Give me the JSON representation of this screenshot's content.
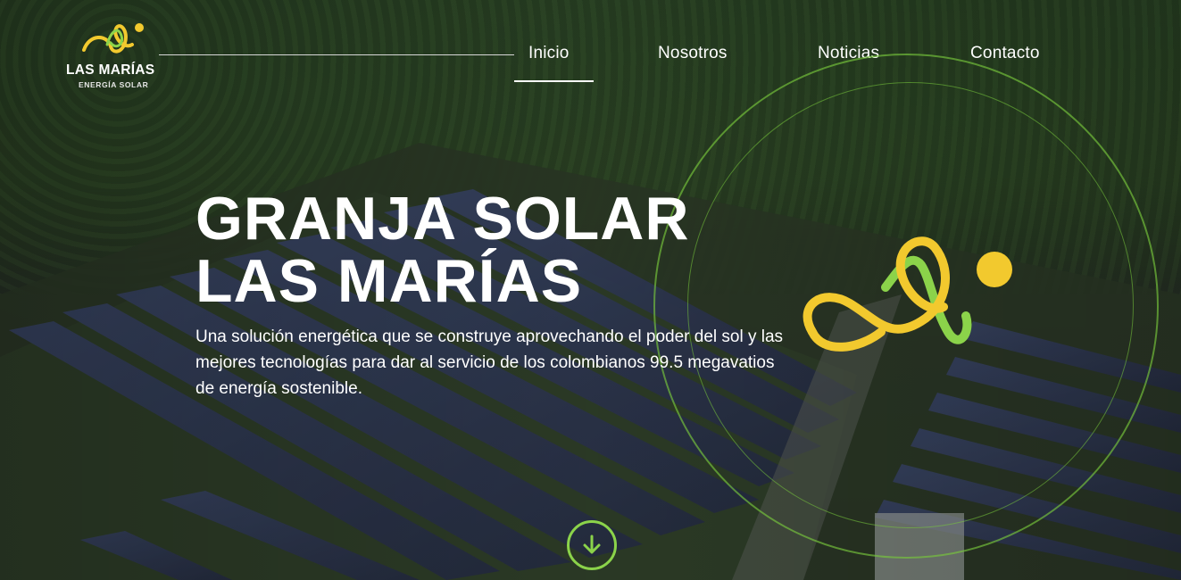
{
  "brand": {
    "name": "LAS MARÍAS",
    "tagline": "ENERGÍA SOLAR"
  },
  "nav": {
    "items": [
      {
        "label": "Inicio",
        "active": true
      },
      {
        "label": "Nosotros",
        "active": false
      },
      {
        "label": "Noticias",
        "active": false
      },
      {
        "label": "Contacto",
        "active": false
      }
    ]
  },
  "hero": {
    "title_line1": "GRANJA SOLAR",
    "title_line2": "LAS MARÍAS",
    "description": "Una solución energética que se construye aprovechando el poder del sol y las mejores tecnologías para dar al servicio de los colombianos 99.5 megavatios de energía sostenible."
  },
  "icons": {
    "logo": "las-marias-logo-icon",
    "scroll": "arrow-down-circle-icon"
  },
  "colors": {
    "accent_green": "#8bd34a",
    "accent_yellow": "#f2c92e",
    "text": "#ffffff"
  }
}
